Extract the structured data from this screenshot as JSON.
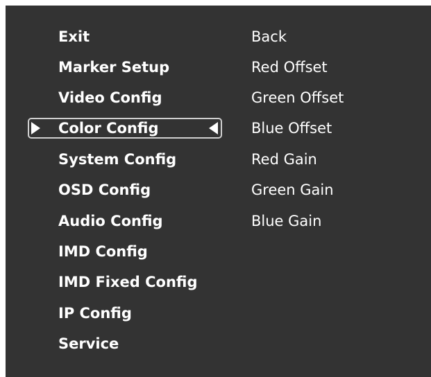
{
  "main_menu": {
    "items": [
      {
        "label": "Exit"
      },
      {
        "label": "Marker Setup"
      },
      {
        "label": "Video Config"
      },
      {
        "label": "Color Config",
        "selected": true
      },
      {
        "label": "System Config"
      },
      {
        "label": "OSD Config"
      },
      {
        "label": "Audio Config"
      },
      {
        "label": "IMD Config"
      },
      {
        "label": "IMD Fixed Config"
      },
      {
        "label": "IP Config"
      },
      {
        "label": "Service"
      }
    ]
  },
  "sub_menu": {
    "items": [
      {
        "label": "Back"
      },
      {
        "label": "Red Offset"
      },
      {
        "label": "Green Offset"
      },
      {
        "label": "Blue Offset"
      },
      {
        "label": "Red Gain"
      },
      {
        "label": "Green Gain"
      },
      {
        "label": "Blue Gain"
      }
    ]
  },
  "colors": {
    "panel_background": "#333333",
    "text": "#ffffff",
    "selector_border": "#d0d0d0"
  },
  "icons": {
    "selection_left": "triangle-right-icon",
    "selection_right": "triangle-left-icon"
  }
}
